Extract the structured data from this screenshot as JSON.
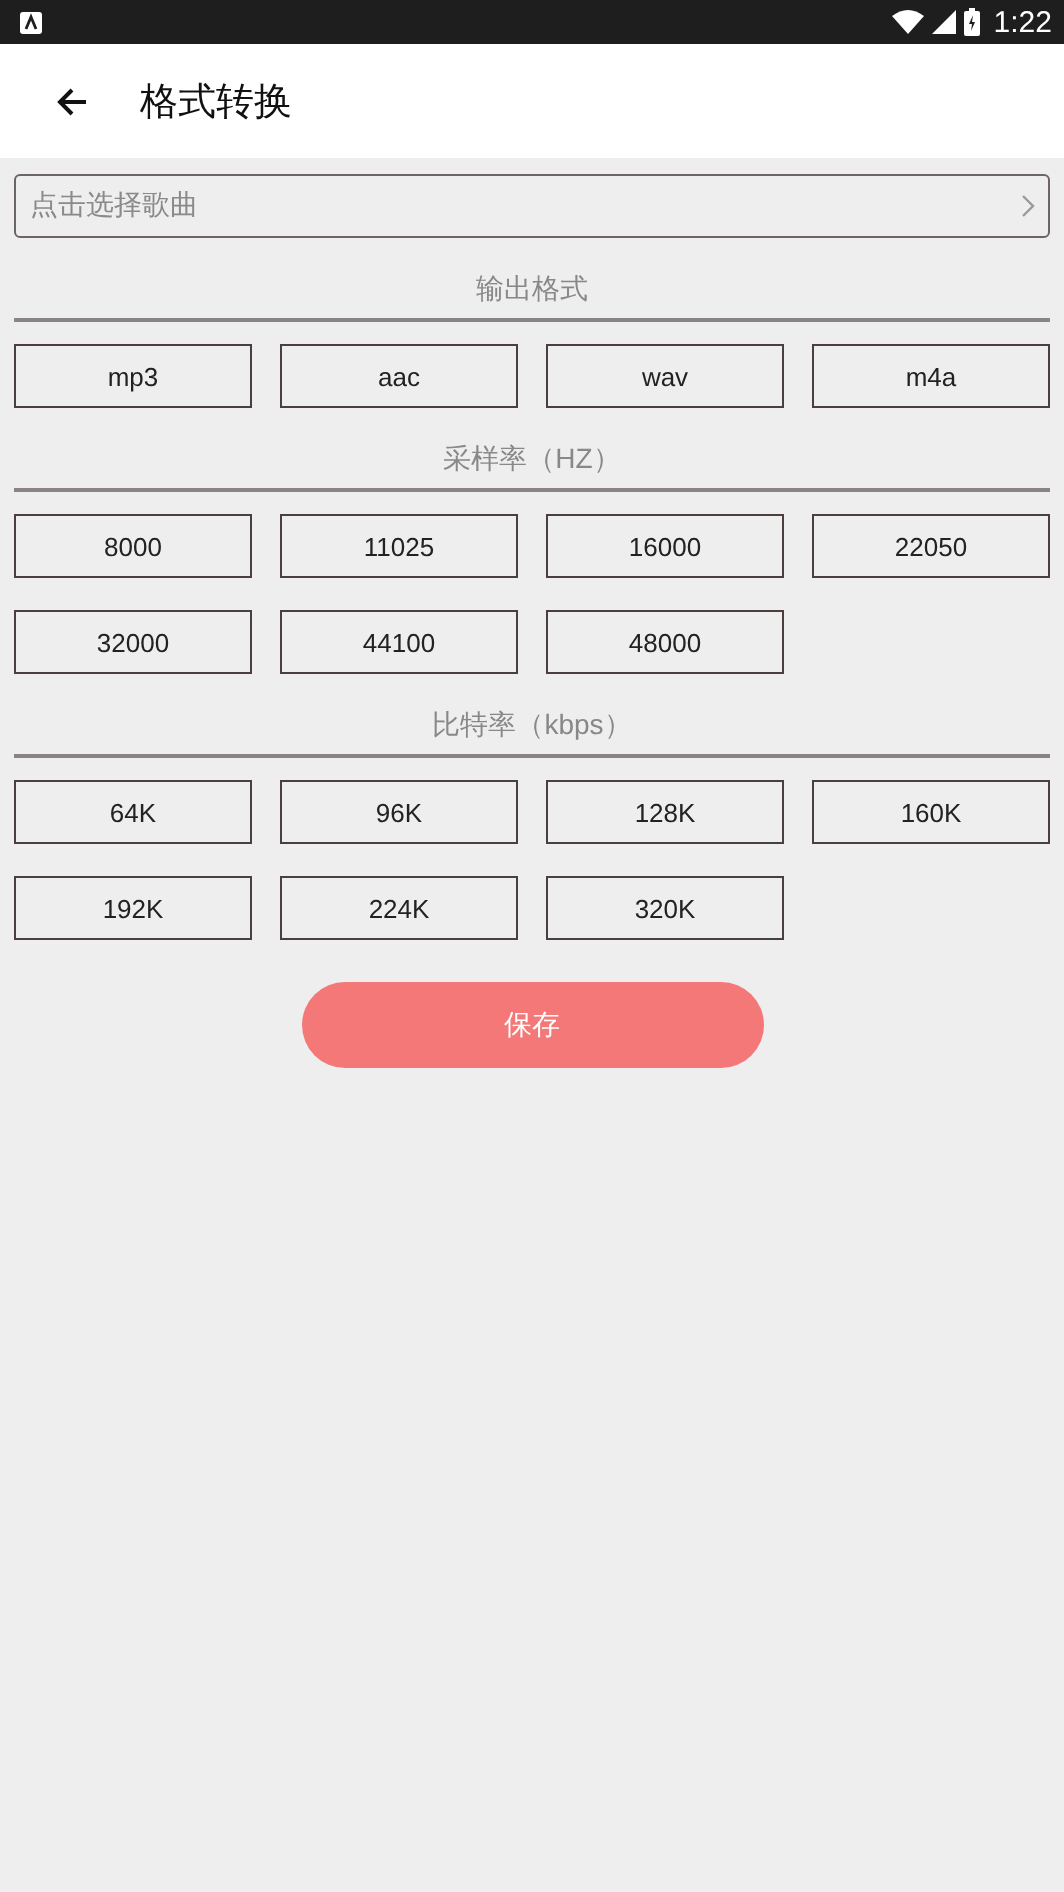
{
  "status_bar": {
    "time": "1:22"
  },
  "toolbar": {
    "title": "格式转换"
  },
  "song_picker": {
    "placeholder": "点击选择歌曲"
  },
  "sections": [
    {
      "title": "输出格式",
      "options": [
        "mp3",
        "aac",
        "wav",
        "m4a"
      ]
    },
    {
      "title": "采样率（HZ）",
      "options": [
        "8000",
        "11025",
        "16000",
        "22050",
        "32000",
        "44100",
        "48000"
      ]
    },
    {
      "title": "比特率（kbps）",
      "options": [
        "64K",
        "96K",
        "128K",
        "160K",
        "192K",
        "224K",
        "320K"
      ]
    }
  ],
  "save_button": {
    "label": "保存"
  }
}
